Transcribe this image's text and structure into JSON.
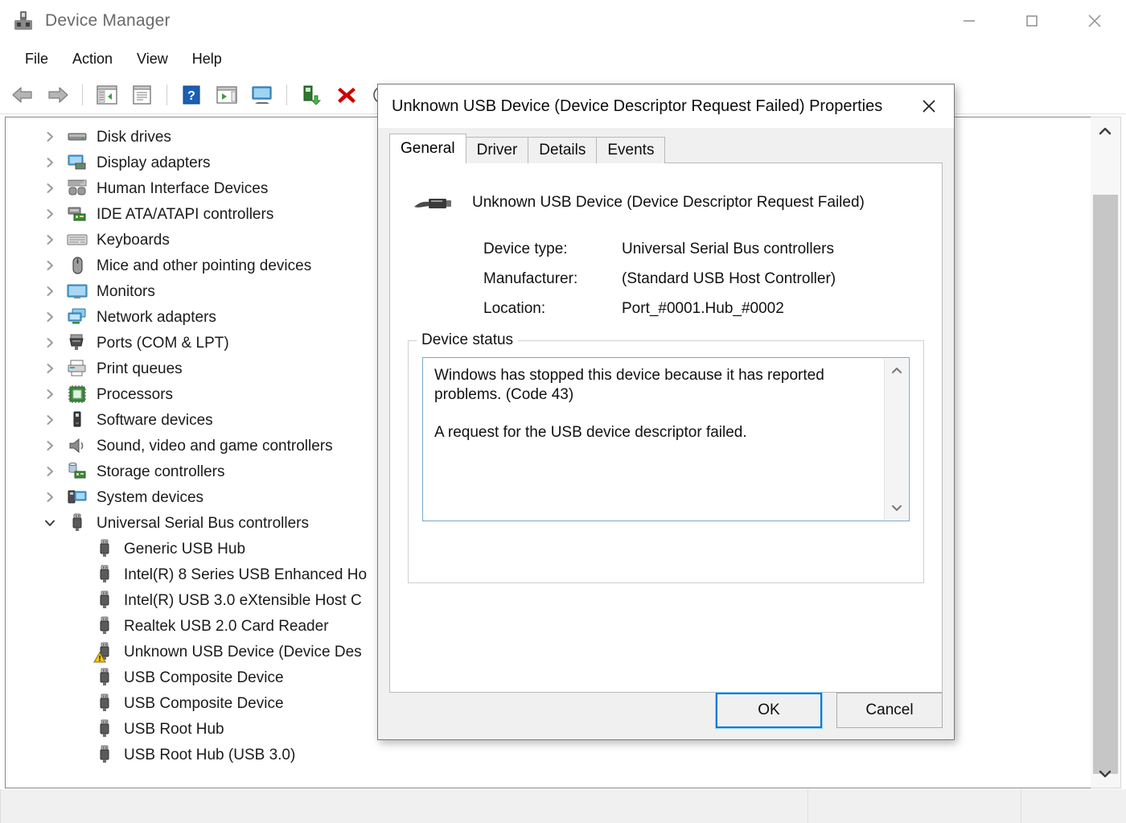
{
  "window": {
    "title": "Device Manager",
    "icon": "device-manager-icon",
    "controls": {
      "minimize": "—",
      "maximize": "□",
      "close": "✕"
    }
  },
  "menubar": {
    "items": [
      {
        "label": "File",
        "name": "menu-file"
      },
      {
        "label": "Action",
        "name": "menu-action"
      },
      {
        "label": "View",
        "name": "menu-view"
      },
      {
        "label": "Help",
        "name": "menu-help"
      }
    ]
  },
  "toolbar": {
    "buttons": [
      {
        "name": "back-icon",
        "glyph": "←"
      },
      {
        "name": "forward-icon",
        "glyph": "→"
      },
      {
        "name": "show-hide-console-tree-icon",
        "glyph": ""
      },
      {
        "name": "properties-icon",
        "glyph": ""
      },
      {
        "name": "help-icon",
        "glyph": "?"
      },
      {
        "name": "scan-for-hardware-changes-icon",
        "glyph": ""
      },
      {
        "name": "update-driver-icon",
        "glyph": ""
      },
      {
        "name": "enable-device-icon",
        "glyph": ""
      },
      {
        "name": "uninstall-device-icon",
        "glyph": "✖"
      },
      {
        "name": "disable-device-icon",
        "glyph": ""
      }
    ]
  },
  "tree": {
    "nodes": [
      {
        "label": "Disk drives",
        "icon": "disk-drive-icon",
        "state": "collapsed",
        "level": 0
      },
      {
        "label": "Display adapters",
        "icon": "display-adapter-icon",
        "state": "collapsed",
        "level": 0
      },
      {
        "label": "Human Interface Devices",
        "icon": "hid-icon",
        "state": "collapsed",
        "level": 0
      },
      {
        "label": "IDE ATA/ATAPI controllers",
        "icon": "ide-controller-icon",
        "state": "collapsed",
        "level": 0
      },
      {
        "label": "Keyboards",
        "icon": "keyboard-icon",
        "state": "collapsed",
        "level": 0
      },
      {
        "label": "Mice and other pointing devices",
        "icon": "mouse-icon",
        "state": "collapsed",
        "level": 0
      },
      {
        "label": "Monitors",
        "icon": "monitor-icon",
        "state": "collapsed",
        "level": 0
      },
      {
        "label": "Network adapters",
        "icon": "network-adapter-icon",
        "state": "collapsed",
        "level": 0
      },
      {
        "label": "Ports (COM & LPT)",
        "icon": "port-icon",
        "state": "collapsed",
        "level": 0
      },
      {
        "label": "Print queues",
        "icon": "printer-icon",
        "state": "collapsed",
        "level": 0
      },
      {
        "label": "Processors",
        "icon": "processor-icon",
        "state": "collapsed",
        "level": 0
      },
      {
        "label": "Software devices",
        "icon": "software-device-icon",
        "state": "collapsed",
        "level": 0
      },
      {
        "label": "Sound, video and game controllers",
        "icon": "sound-device-icon",
        "state": "collapsed",
        "level": 0
      },
      {
        "label": "Storage controllers",
        "icon": "storage-controller-icon",
        "state": "collapsed",
        "level": 0
      },
      {
        "label": "System devices",
        "icon": "system-device-icon",
        "state": "collapsed",
        "level": 0
      },
      {
        "label": "Universal Serial Bus controllers",
        "icon": "usb-icon",
        "state": "expanded",
        "level": 0
      },
      {
        "label": "Generic USB Hub",
        "icon": "usb-icon",
        "state": "leaf",
        "level": 1
      },
      {
        "label": "Intel(R) 8 Series USB Enhanced Ho",
        "icon": "usb-icon",
        "state": "leaf",
        "level": 1
      },
      {
        "label": "Intel(R) USB 3.0 eXtensible Host C",
        "icon": "usb-icon",
        "state": "leaf",
        "level": 1
      },
      {
        "label": "Realtek USB 2.0 Card Reader",
        "icon": "usb-icon",
        "state": "leaf",
        "level": 1
      },
      {
        "label": "Unknown USB Device (Device Des",
        "icon": "usb-warning-icon",
        "state": "leaf",
        "level": 1,
        "warning": true
      },
      {
        "label": "USB Composite Device",
        "icon": "usb-icon",
        "state": "leaf",
        "level": 1
      },
      {
        "label": "USB Composite Device",
        "icon": "usb-icon",
        "state": "leaf",
        "level": 1
      },
      {
        "label": "USB Root Hub",
        "icon": "usb-icon",
        "state": "leaf",
        "level": 1
      },
      {
        "label": "USB Root Hub (USB 3.0)",
        "icon": "usb-icon",
        "state": "leaf",
        "level": 1
      }
    ]
  },
  "scrollbar": {
    "up_glyph": "⌃",
    "down_glyph": "⌄"
  },
  "dialog": {
    "title": "Unknown USB Device (Device Descriptor Request Failed) Properties",
    "close_glyph": "✕",
    "tabs": [
      {
        "label": "General",
        "active": true
      },
      {
        "label": "Driver",
        "active": false
      },
      {
        "label": "Details",
        "active": false
      },
      {
        "label": "Events",
        "active": false
      }
    ],
    "device": {
      "name": "Unknown USB Device (Device Descriptor Request Failed)",
      "icon": "usb-plug-icon",
      "properties": [
        {
          "key": "Device type:",
          "value": "Universal Serial Bus controllers"
        },
        {
          "key": "Manufacturer:",
          "value": "(Standard USB Host Controller)"
        },
        {
          "key": "Location:",
          "value": "Port_#0001.Hub_#0002"
        }
      ]
    },
    "device_status": {
      "legend": "Device status",
      "line1": "Windows has stopped this device because it has reported problems. (Code 43)",
      "line2": "A request for the USB device descriptor failed.",
      "scroll_up_glyph": "⌃",
      "scroll_down_glyph": "⌄"
    },
    "buttons": {
      "ok": "OK",
      "cancel": "Cancel"
    }
  },
  "colors": {
    "accent": "#0078d7",
    "warning": "#f0c000",
    "error_x": "#cc0000",
    "status_border": "#7aa7c7"
  }
}
